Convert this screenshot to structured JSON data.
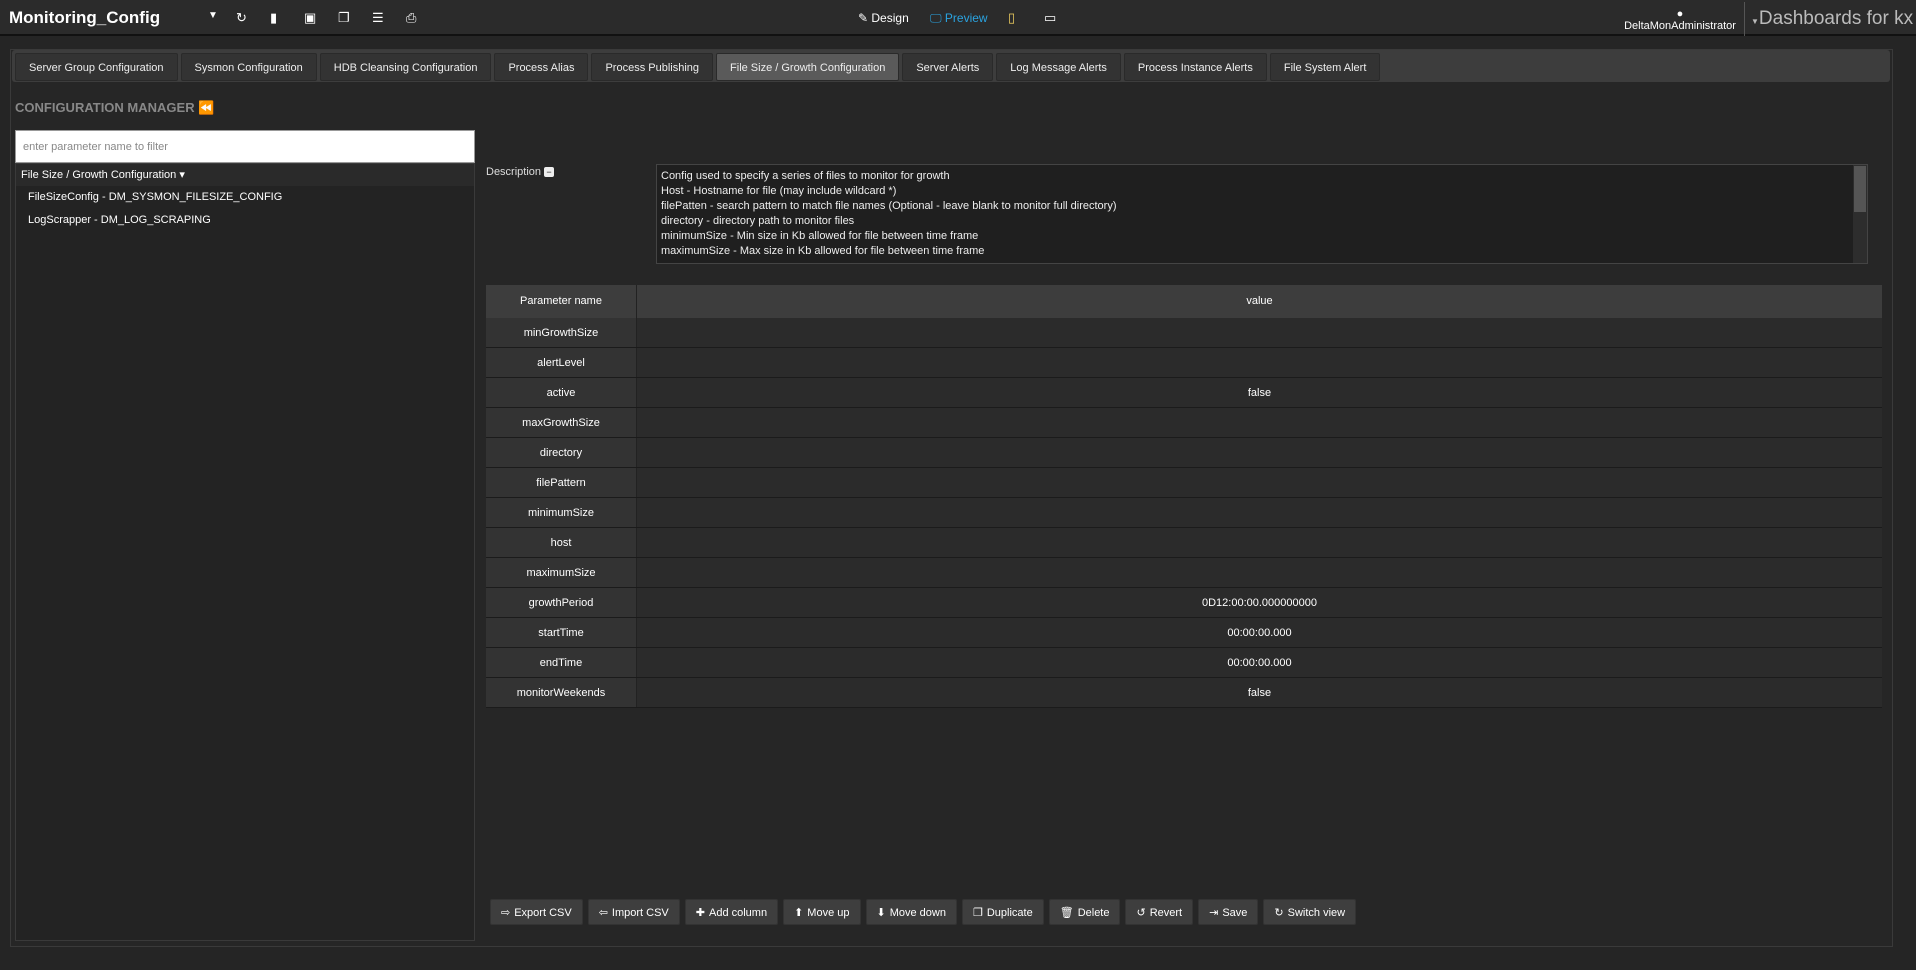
{
  "topbar": {
    "title": "Monitoring_Config",
    "design": "Design",
    "preview": "Preview",
    "user": "DeltaMonAdministrator",
    "brand": "Dashboards for kx",
    "accent": "#2aa3e0"
  },
  "tabs": [
    "Server Group Configuration",
    "Sysmon Configuration",
    "HDB Cleansing Configuration",
    "Process Alias",
    "Process Publishing",
    "File Size / Growth Configuration",
    "Server Alerts",
    "Log Message Alerts",
    "Process Instance Alerts",
    "File System Alert"
  ],
  "active_tab": "File Size / Growth Configuration",
  "sidebar": {
    "title": "CONFIGURATION MANAGER",
    "filter_placeholder": "enter parameter name to filter",
    "group": "File Size / Growth Configuration",
    "items": [
      "FileSizeConfig - DM_SYSMON_FILESIZE_CONFIG",
      "LogScrapper - DM_LOG_SCRAPING"
    ]
  },
  "description": {
    "label": "Description",
    "lines": [
      "Config used to specify a series of files to monitor for growth",
      "Host - Hostname for file (may include wildcard *)",
      "filePatten - search pattern to match file names (Optional - leave blank to monitor full directory)",
      "directory - directory path to monitor files",
      "minimumSize -  Min size in Kb allowed for file between time frame",
      "maximumSize - Max size in Kb allowed for file between time frame"
    ]
  },
  "grid": {
    "headers": [
      "Parameter name",
      "value"
    ],
    "rows": [
      [
        "minGrowthSize",
        ""
      ],
      [
        "alertLevel",
        ""
      ],
      [
        "active",
        "false"
      ],
      [
        "maxGrowthSize",
        ""
      ],
      [
        "directory",
        ""
      ],
      [
        "filePattern",
        ""
      ],
      [
        "minimumSize",
        ""
      ],
      [
        "host",
        ""
      ],
      [
        "maximumSize",
        ""
      ],
      [
        "growthPeriod",
        "0D12:00:00.000000000"
      ],
      [
        "startTime",
        "00:00:00.000"
      ],
      [
        "endTime",
        "00:00:00.000"
      ],
      [
        "monitorWeekends",
        "false"
      ]
    ]
  },
  "buttons": [
    {
      "icon": "export-icon",
      "glyph": "⇨",
      "label": "Export CSV"
    },
    {
      "icon": "import-icon",
      "glyph": "⇦",
      "label": "Import CSV"
    },
    {
      "icon": "plus-icon",
      "glyph": "✚",
      "label": "Add column"
    },
    {
      "icon": "arrow-up-icon",
      "glyph": "⬆",
      "label": "Move up"
    },
    {
      "icon": "arrow-down-icon",
      "glyph": "⬇",
      "label": "Move down"
    },
    {
      "icon": "copy-icon",
      "glyph": "❐",
      "label": "Duplicate"
    },
    {
      "icon": "trash-icon",
      "glyph": "🗑",
      "label": "Delete"
    },
    {
      "icon": "undo-icon",
      "glyph": "↺",
      "label": "Revert"
    },
    {
      "icon": "save-icon",
      "glyph": "⇥",
      "label": "Save"
    },
    {
      "icon": "refresh-icon",
      "glyph": "↻",
      "label": "Switch view"
    }
  ]
}
